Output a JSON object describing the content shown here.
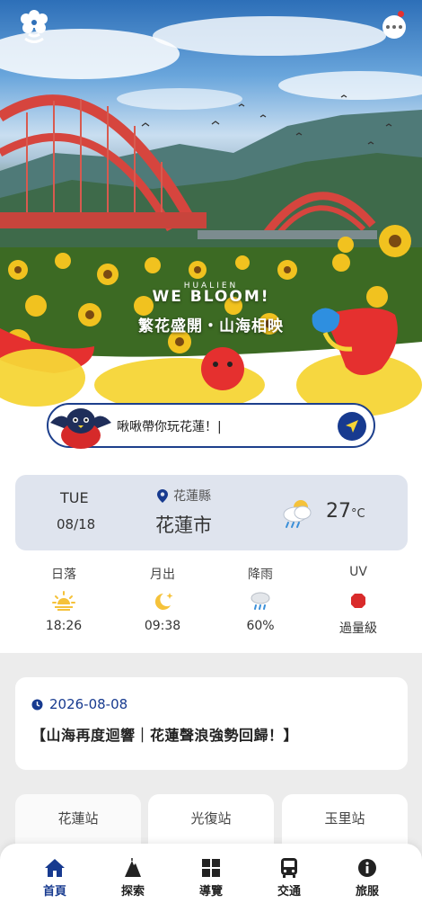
{
  "hero": {
    "brand_small": "HUALIEN",
    "brand": "WE BLOOM!",
    "subtitle": "繁花盛開・山海相映"
  },
  "chat": {
    "placeholder": "啾啾帶你玩花蓮！|"
  },
  "weather": {
    "day": "TUE",
    "date": "08/18",
    "county": "花蓮縣",
    "city": "花蓮市",
    "temperature": "27",
    "unit": "°C",
    "condition_icon": "cloud-rain-sun-icon",
    "stats": [
      {
        "label": "日落",
        "value": "18:26",
        "icon": "sunset-icon"
      },
      {
        "label": "月出",
        "value": "09:38",
        "icon": "moonrise-icon"
      },
      {
        "label": "降雨",
        "value": "60%",
        "icon": "rain-icon"
      },
      {
        "label": "UV",
        "value": "過量級",
        "icon": "uv-icon"
      }
    ]
  },
  "news": {
    "date": "2026-08-08",
    "title": "【山海再度迴響｜花蓮聲浪強勢回歸！】"
  },
  "stations": [
    "花蓮站",
    "光復站",
    "玉里站"
  ],
  "nav": [
    {
      "label": "首頁",
      "icon": "home-icon",
      "active": true
    },
    {
      "label": "探索",
      "icon": "explore-icon",
      "active": false
    },
    {
      "label": "導覽",
      "icon": "grid-icon",
      "active": false
    },
    {
      "label": "交通",
      "icon": "bus-icon",
      "active": false
    },
    {
      "label": "旅服",
      "icon": "info-icon",
      "active": false
    }
  ],
  "colors": {
    "primary": "#173a8f",
    "accent_red": "#e5302f",
    "accent_yellow": "#f5d536",
    "weather_card": "#dfe4ee"
  }
}
